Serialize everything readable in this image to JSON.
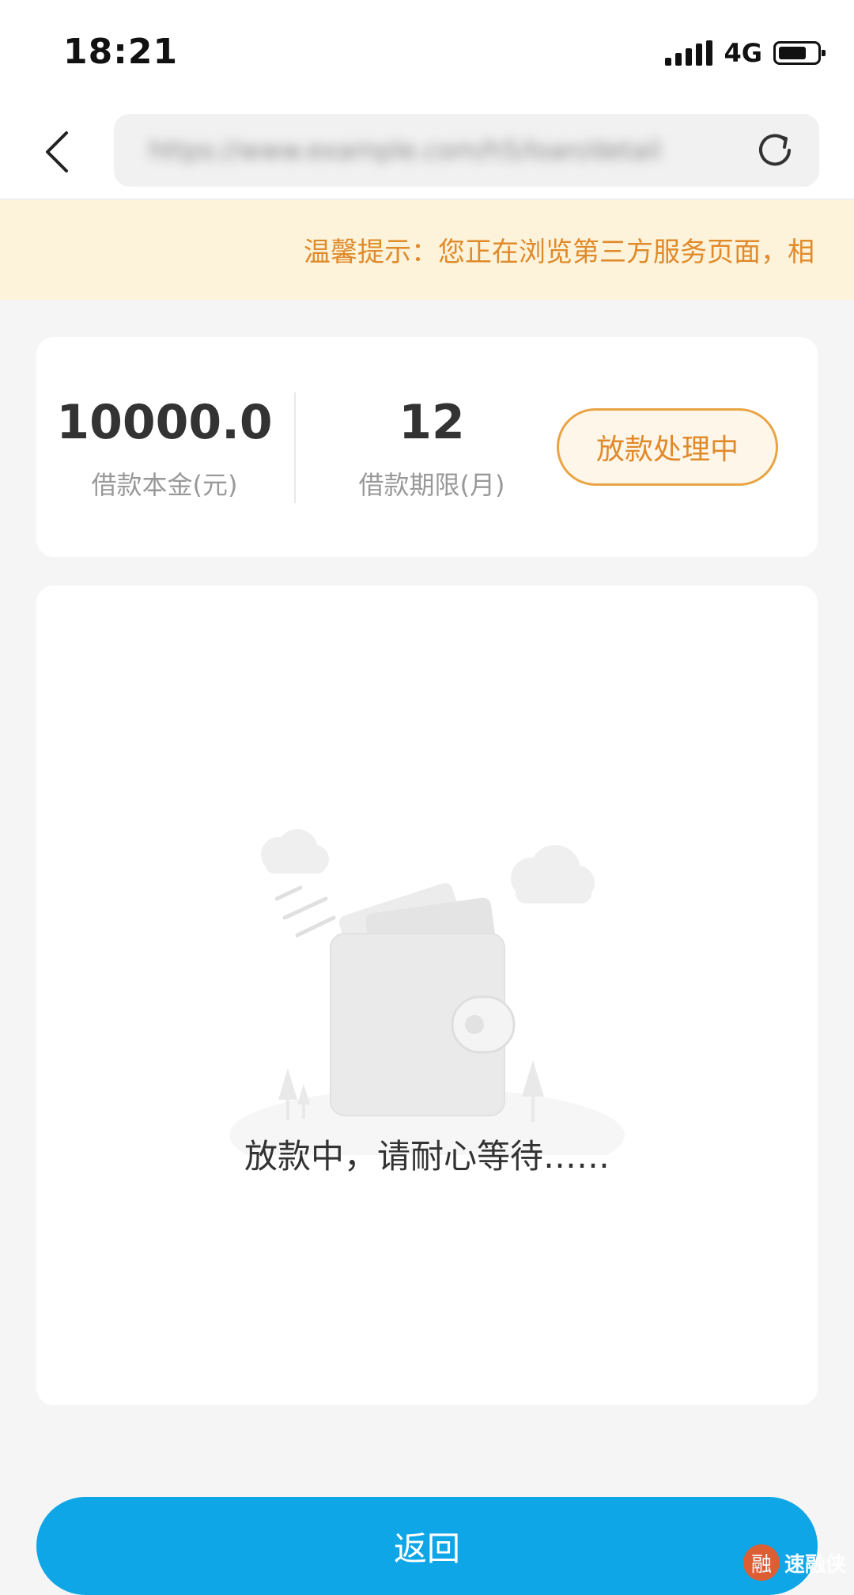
{
  "status_bar": {
    "time": "18:21",
    "network": "4G",
    "signal_icon": "signal-bars-icon",
    "battery_icon": "battery-icon"
  },
  "nav": {
    "back_icon": "chevron-left-icon",
    "url": "https://www.example.com/h5/loan/detail",
    "refresh_icon": "refresh-icon"
  },
  "notice": {
    "text": "温馨提示：您正在浏览第三方服务页面，相"
  },
  "summary": {
    "amount_value": "10000.0",
    "amount_label": "借款本金(元)",
    "term_value": "12",
    "term_label": "借款期限(月)",
    "status": "放款处理中"
  },
  "content": {
    "illustration": "wallet-illustration",
    "message": "放款中，请耐心等待……"
  },
  "footer": {
    "return_label": "返回"
  },
  "watermark": {
    "logo_char": "融",
    "text": "速融侠"
  },
  "colors": {
    "primary": "#0ea6e6",
    "notice_bg": "#fdf3da",
    "notice_text": "#e08a2a",
    "status_border": "#e9a444"
  }
}
